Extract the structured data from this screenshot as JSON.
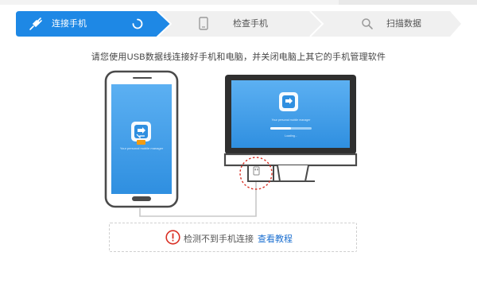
{
  "steps": [
    {
      "label": "连接手机",
      "state": "active"
    },
    {
      "label": "检查手机",
      "state": "pending"
    },
    {
      "label": "扫描数据",
      "state": "pending"
    }
  ],
  "instruction": "请您使用USB数据线连接好手机和电脑，并关闭电脑上其它的手机管理软件",
  "phone_screen": {
    "caption": "Your personal mobile manager"
  },
  "monitor_screen": {
    "caption": "Your personal mobile manager",
    "progress_text": "Loading...",
    "progress": 0.5
  },
  "status": {
    "message": "检测不到手机连接",
    "link_label": "查看教程"
  },
  "colors": {
    "accent": "#1e88e5",
    "step_inactive": "#f0f0f0",
    "warning": "#d93025",
    "link": "#1b6fd0",
    "screen_blue": "#3d9be9"
  },
  "icons": {
    "step1": "plug-icon",
    "step1_spinner": "spinner-icon",
    "step2": "phone-icon",
    "step3": "search-icon",
    "status": "warning-icon",
    "usb": "usb-plug-icon"
  }
}
